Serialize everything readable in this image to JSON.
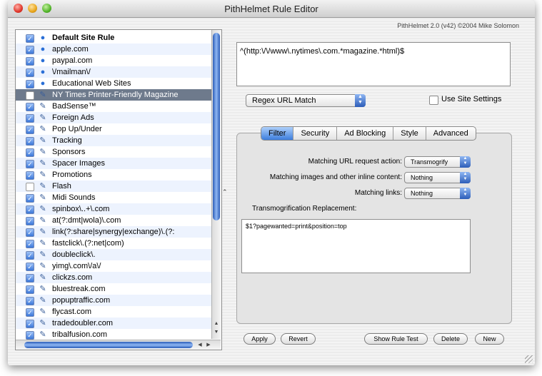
{
  "window": {
    "title": "PithHelmet Rule Editor",
    "credit": "PithHelmet 2.0 (v42) ©2004 Mike Solomon"
  },
  "rules": [
    {
      "label": "Default Site Rule",
      "checked": true,
      "icon": "globe-icon",
      "glyph": "●"
    },
    {
      "label": "apple.com",
      "checked": true,
      "icon": "globe-icon",
      "glyph": "●"
    },
    {
      "label": "paypal.com",
      "checked": true,
      "icon": "globe-icon",
      "glyph": "●"
    },
    {
      "label": "\\/mailman\\/",
      "checked": true,
      "icon": "globe-icon",
      "glyph": "●"
    },
    {
      "label": "Educational Web Sites",
      "checked": true,
      "icon": "globe-icon",
      "glyph": "●"
    },
    {
      "label": "NY Times Printer-Friendly Magazine",
      "checked": false,
      "icon": "pith-helmet-icon",
      "glyph": "✎"
    },
    {
      "label": "BadSense™",
      "checked": true,
      "icon": "pith-helmet-icon",
      "glyph": "✎"
    },
    {
      "label": "Foreign Ads",
      "checked": true,
      "icon": "pith-helmet-icon",
      "glyph": "✎"
    },
    {
      "label": "Pop Up/Under",
      "checked": true,
      "icon": "pith-helmet-icon",
      "glyph": "✎"
    },
    {
      "label": "Tracking",
      "checked": true,
      "icon": "pith-helmet-icon",
      "glyph": "✎"
    },
    {
      "label": "Sponsors",
      "checked": true,
      "icon": "pith-helmet-icon",
      "glyph": "✎"
    },
    {
      "label": "Spacer Images",
      "checked": true,
      "icon": "pith-helmet-icon",
      "glyph": "✎"
    },
    {
      "label": "Promotions",
      "checked": true,
      "icon": "pith-helmet-icon",
      "glyph": "✎"
    },
    {
      "label": "Flash",
      "checked": false,
      "icon": "pith-helmet-icon",
      "glyph": "✎"
    },
    {
      "label": "Midi Sounds",
      "checked": true,
      "icon": "pith-helmet-icon",
      "glyph": "✎"
    },
    {
      "label": "spinbox\\..+\\.com",
      "checked": true,
      "icon": "pith-helmet-icon",
      "glyph": "✎"
    },
    {
      "label": "at(?:dmt|wola)\\.com",
      "checked": true,
      "icon": "pith-helmet-icon",
      "glyph": "✎"
    },
    {
      "label": "link(?:share|synergy|exchange)\\.(?:",
      "checked": true,
      "icon": "pith-helmet-icon",
      "glyph": "✎"
    },
    {
      "label": "fastclick\\.(?:net|com)",
      "checked": true,
      "icon": "pith-helmet-icon",
      "glyph": "✎"
    },
    {
      "label": "doubleclick\\.",
      "checked": true,
      "icon": "pith-helmet-icon",
      "glyph": "✎"
    },
    {
      "label": "yimg\\.com\\/a\\/",
      "checked": true,
      "icon": "pith-helmet-icon",
      "glyph": "✎"
    },
    {
      "label": "clickzs.com",
      "checked": true,
      "icon": "pith-helmet-icon",
      "glyph": "✎"
    },
    {
      "label": "bluestreak.com",
      "checked": true,
      "icon": "pith-helmet-icon",
      "glyph": "✎"
    },
    {
      "label": "popuptraffic.com",
      "checked": true,
      "icon": "pith-helmet-icon",
      "glyph": "✎"
    },
    {
      "label": "flycast.com",
      "checked": true,
      "icon": "pith-helmet-icon",
      "glyph": "✎"
    },
    {
      "label": "tradedoubler.com",
      "checked": true,
      "icon": "pith-helmet-icon",
      "glyph": "✎"
    },
    {
      "label": "tribalfusion.com",
      "checked": true,
      "icon": "pith-helmet-icon",
      "glyph": "✎"
    }
  ],
  "selected_index": 5,
  "pattern": "^(http:\\/\\/www\\.nytimes\\.com.*magazine.*html)$",
  "match_type": "Regex URL Match",
  "use_site_settings": {
    "label": "Use Site Settings",
    "checked": false
  },
  "tabs": [
    {
      "label": "Filter",
      "active": true
    },
    {
      "label": "Security",
      "active": false
    },
    {
      "label": "Ad Blocking",
      "active": false
    },
    {
      "label": "Style",
      "active": false
    },
    {
      "label": "Advanced",
      "active": false
    }
  ],
  "filter": {
    "url_action_label": "Matching URL request action:",
    "url_action_value": "Transmogrify",
    "images_label": "Matching images and other inline content:",
    "images_value": "Nothing",
    "links_label": "Matching links:",
    "links_value": "Nothing",
    "replacement_label": "Transmogrification Replacement:",
    "replacement_value": "$1?pagewanted=print&position=top"
  },
  "buttons": {
    "apply": "Apply",
    "revert": "Revert",
    "show_rule_test": "Show Rule Test",
    "delete": "Delete",
    "new": "New"
  },
  "colors": {
    "selection": "#6e7a8c",
    "accent": "#3c7ddc",
    "alt_row": "#edf3fe"
  }
}
